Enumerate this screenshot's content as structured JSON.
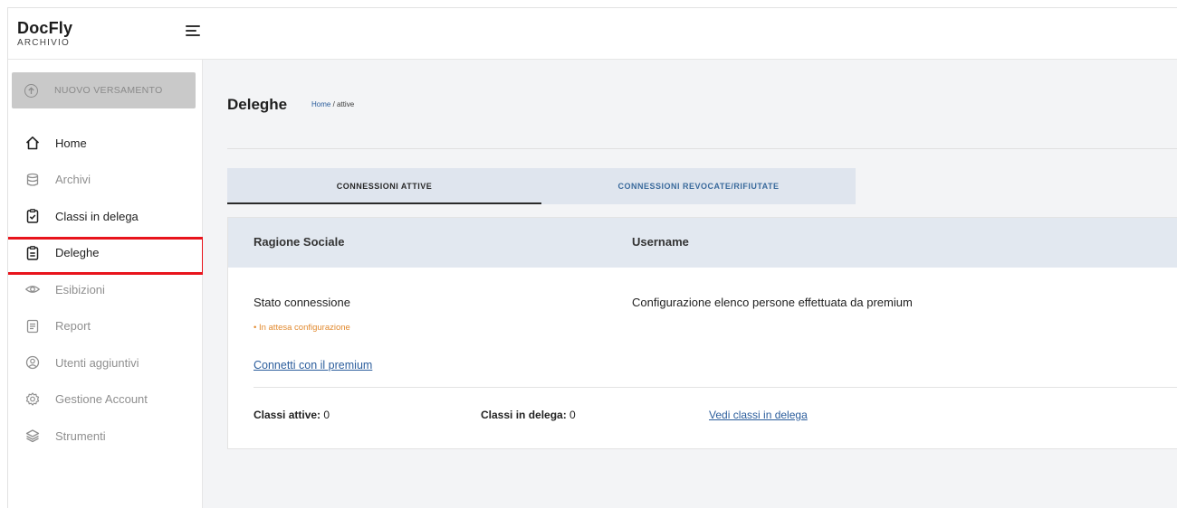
{
  "brand": {
    "name": "DocFly",
    "subtitle": "ARCHIVIO"
  },
  "sidebar": {
    "new_button": "NUOVO VERSAMENTO",
    "items": [
      {
        "label": "Home",
        "icon": "home-icon"
      },
      {
        "label": "Archivi",
        "icon": "database-icon"
      },
      {
        "label": "Classi in delega",
        "icon": "clipboard-check-icon"
      },
      {
        "label": "Deleghe",
        "icon": "clipboard-list-icon",
        "active": true
      },
      {
        "label": "Esibizioni",
        "icon": "eye-icon"
      },
      {
        "label": "Report",
        "icon": "report-icon"
      },
      {
        "label": "Utenti aggiuntivi",
        "icon": "user-circle-icon"
      },
      {
        "label": "Gestione Account",
        "icon": "gear-icon"
      },
      {
        "label": "Strumenti",
        "icon": "layers-icon"
      }
    ]
  },
  "main": {
    "title": "Deleghe",
    "breadcrumb": {
      "home": "Home",
      "sep": " / ",
      "current": "attive"
    },
    "tabs": [
      {
        "label": "CONNESSIONI ATTIVE",
        "active": true
      },
      {
        "label": "CONNESSIONI REVOCATE/RIFIUTATE",
        "active": false
      }
    ],
    "card": {
      "col1_header": "Ragione Sociale",
      "col2_header": "Username",
      "stato_label": "Stato connessione",
      "config_label": "Configurazione elenco persone effettuata da premium",
      "status": "• In attesa configurazione",
      "connect_link": "Connetti con il premium",
      "classi_attive_label": "Classi attive:",
      "classi_attive_value": " 0",
      "classi_delega_label": "Classi in delega:",
      "classi_delega_value": " 0",
      "vedi_link": "Vedi classi in delega"
    }
  },
  "colors": {
    "accent_link": "#2b5d9c",
    "status_pending": "#e28a2f",
    "highlight_box": "#e8141c"
  }
}
